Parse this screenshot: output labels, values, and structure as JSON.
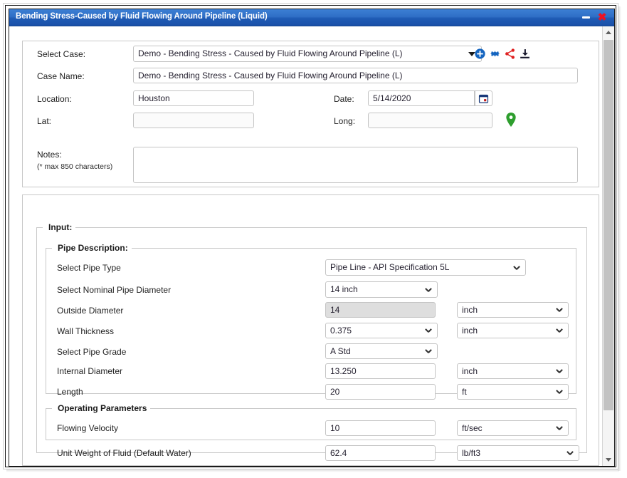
{
  "window": {
    "title": "Bending Stress-Caused by Fluid Flowing Around Pipeline (Liquid)",
    "minimize_label": "",
    "close_label": "✖"
  },
  "case_header": {
    "select_case_label": "Select Case:",
    "select_case_value": "Demo - Bending Stress - Caused by Fluid Flowing Around Pipeline (L)",
    "case_name_label": "Case Name:",
    "case_name_value": "Demo - Bending Stress - Caused by Fluid Flowing Around Pipeline (L)",
    "location_label": "Location:",
    "location_value": "Houston",
    "date_label": "Date:",
    "date_value": "5/14/2020",
    "lat_label": "Lat:",
    "lat_value": "",
    "lat_placeholder": "",
    "long_label": "Long:",
    "long_value": "",
    "long_placeholder": "",
    "notes_label": "Notes:",
    "notes_hint": "(* max 850 characters)",
    "notes_value": "",
    "notes_placeholder": "",
    "toolbar": [
      {
        "name": "add-case-icon",
        "title": "Add"
      },
      {
        "name": "settings-gear-icon",
        "title": "Settings"
      },
      {
        "name": "share-icon",
        "title": "Share"
      },
      {
        "name": "download-icon",
        "title": "Download"
      }
    ],
    "calendar_icon": "calendar-icon",
    "map_pin_icon": "map-pin-icon"
  },
  "input_section": {
    "legend": "Input:",
    "pipe_description": {
      "legend": "Pipe Description:",
      "rows": [
        {
          "label": "Select Pipe Type",
          "control": "select",
          "value": "Pipe Line - API Specification 5L",
          "unit": "",
          "unit_control": "none"
        },
        {
          "label": "Select Nominal Pipe Diameter",
          "control": "select",
          "value": "14 inch",
          "unit": "",
          "unit_control": "none"
        },
        {
          "label": "Outside Diameter",
          "control": "readonly",
          "value": "14",
          "unit": "inch",
          "unit_control": "select"
        },
        {
          "label": "Wall Thickness",
          "control": "select",
          "value": "0.375",
          "unit": "inch",
          "unit_control": "select"
        },
        {
          "label": "Select Pipe Grade",
          "control": "select",
          "value": "A Std",
          "unit": "",
          "unit_control": "none"
        },
        {
          "label": "Internal Diameter",
          "control": "text",
          "value": "13.250",
          "unit": "inch",
          "unit_control": "select"
        },
        {
          "label": "Length",
          "control": "text",
          "value": "20",
          "unit": "ft",
          "unit_control": "select"
        }
      ]
    },
    "operating_parameters": {
      "legend": "Operating Parameters",
      "rows": [
        {
          "label": "Flowing Velocity",
          "control": "text",
          "value": "10",
          "unit": "ft/sec",
          "unit_control": "select"
        }
      ]
    },
    "extra_rows": [
      {
        "label": "Unit Weight of Fluid (Default Water)",
        "control": "text",
        "value": "62.4",
        "unit": "lb/ft3",
        "unit_control": "select"
      }
    ]
  },
  "colors": {
    "titlebar_blue": "#2f6fc6",
    "close_red": "#ee1122",
    "accent_blue": "#1565c0",
    "share_red": "#e02020",
    "pin_green": "#2e9e2e"
  }
}
